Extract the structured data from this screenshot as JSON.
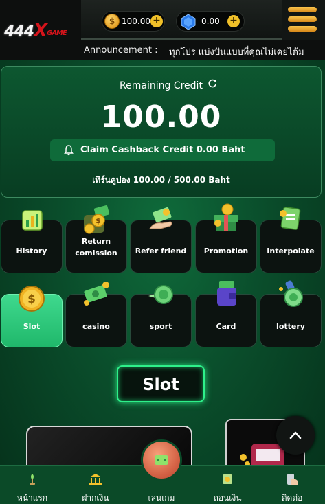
{
  "header": {
    "logo_num": "444",
    "logo_x": "X",
    "logo_game": "GAME",
    "credit_balance": "100.00",
    "gem_balance": "0.00",
    "plus_symbol": "+"
  },
  "announcement": {
    "label": "Announcement :",
    "text": "ทุกโปร แบ่งปันแบบที่คุณไม่เคยได้ม"
  },
  "credit_card": {
    "title": "Remaining Credit",
    "amount": "100.00",
    "cashback_label": "Claim Cashback Credit  0.00  Baht",
    "coupon_text": "เทิร์นคูปอง 100.00  /  500.00 Baht"
  },
  "menu_tiles": [
    {
      "label": "History",
      "icon": "chart-icon"
    },
    {
      "label": "Return\ncomission",
      "icon": "money-box-icon"
    },
    {
      "label": "Refer friend",
      "icon": "hand-money-icon"
    },
    {
      "label": "Promotion",
      "icon": "gift-icon"
    },
    {
      "label": "Interpolate",
      "icon": "clipboard-icon"
    }
  ],
  "game_tiles": [
    {
      "label": "Slot",
      "icon": "coin-icon",
      "active": true
    },
    {
      "label": "casino",
      "icon": "cash-icon",
      "active": false
    },
    {
      "label": "sport",
      "icon": "flying-coin-icon",
      "active": false
    },
    {
      "label": "Card",
      "icon": "wallet-icon",
      "active": false
    },
    {
      "label": "lottery",
      "icon": "stamp-icon",
      "active": false
    }
  ],
  "section_title": "Slot",
  "bottom_nav": [
    {
      "label": "หน้าแรก",
      "icon": "home-icon"
    },
    {
      "label": "ฝากเงิน",
      "icon": "bank-icon"
    },
    {
      "label": "เล่นเกม",
      "icon": "game-icon"
    },
    {
      "label": "ถอนเงิน",
      "icon": "withdraw-icon"
    },
    {
      "label": "ติดต่อ",
      "icon": "contact-icon"
    }
  ],
  "colors": {
    "accent_green": "#2ef08a",
    "active_tile": "#3fd98e",
    "gold": "#f0c029",
    "logo_red": "#d4141b"
  }
}
